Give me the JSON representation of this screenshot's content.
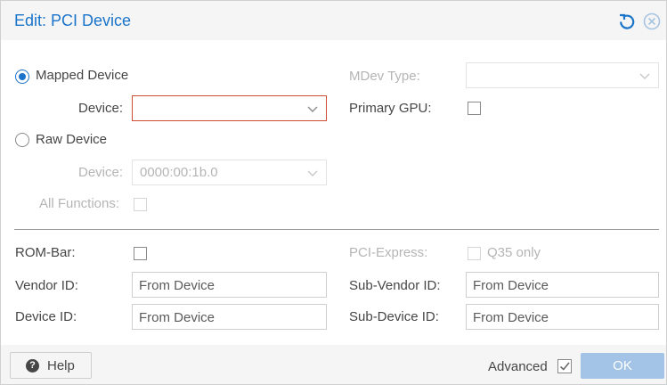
{
  "dialog": {
    "title": "Edit: PCI Device"
  },
  "mapped_device": {
    "label": "Mapped Device",
    "selected": true,
    "device_label": "Device:",
    "device_value": ""
  },
  "raw_device": {
    "label": "Raw Device",
    "selected": false,
    "device_label": "Device:",
    "device_value": "0000:00:1b.0",
    "all_functions_label": "All Functions:"
  },
  "mdev": {
    "label": "MDev Type:",
    "value": ""
  },
  "primary_gpu": {
    "label": "Primary GPU:",
    "checked": false
  },
  "rom_bar": {
    "label": "ROM-Bar:",
    "checked": false
  },
  "pci_express": {
    "label": "PCI-Express:",
    "option_label": "Q35 only",
    "checked": false
  },
  "vendor_id": {
    "label": "Vendor ID:",
    "placeholder": "From Device"
  },
  "device_id": {
    "label": "Device ID:",
    "placeholder": "From Device"
  },
  "sub_vendor_id": {
    "label": "Sub-Vendor ID:",
    "placeholder": "From Device"
  },
  "sub_device_id": {
    "label": "Sub-Device ID:",
    "placeholder": "From Device"
  },
  "footer": {
    "help_label": "Help",
    "advanced_label": "Advanced",
    "advanced_checked": true,
    "ok_label": "OK"
  },
  "colors": {
    "accent": "#1a74c9",
    "invalid_border": "#cf4c35",
    "ok_button_disabled": "#a3c4e6"
  },
  "icons": {
    "reset": "reset-icon",
    "close": "close-icon",
    "help": "help-icon",
    "dropdown": "chevron-down-icon"
  }
}
